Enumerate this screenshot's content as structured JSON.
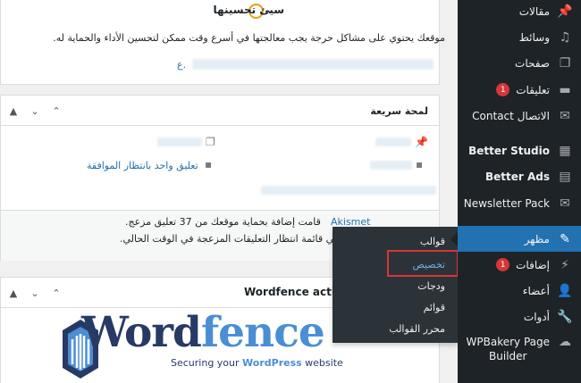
{
  "health": {
    "title": "سيئ تحسينها",
    "description": "موقعك يحتوي على مشاكل حرجة يجب معالجتها في أسرع وقت ممكن لتحسين الأداء والحماية له.",
    "link_fragment": "ع."
  },
  "glance": {
    "title": "لمحة سريعة",
    "pending_comment": "تعليق واحد بانتظار الموافقة",
    "akismet_line1": "قامت إضافة                  بحماية موقعك من 37 تعليق مزعج.",
    "akismet_link": "Akismet",
    "akismet_line2": "لا يوجد أي شيء في قائمة انتظار التعليقات المزعجة في الوقت الحالي."
  },
  "wordfence": {
    "title": "Wordfence activi",
    "logo_word_a": "Word",
    "logo_word_b": "fence",
    "tagline_a": "Securing your ",
    "tagline_b": "WordPress",
    "tagline_c": " website"
  },
  "sidebar": {
    "items": [
      {
        "label": "مقالات",
        "icon": "pin-icon"
      },
      {
        "label": "وسائط",
        "icon": "media-icon"
      },
      {
        "label": "صفحات",
        "icon": "pages-icon"
      },
      {
        "label": "تعليقات",
        "icon": "comments-icon",
        "badge": "1"
      },
      {
        "label": "Contact الاتصال",
        "icon": "mail-icon"
      },
      {
        "label": "Better Studio",
        "icon": "studio-icon"
      },
      {
        "label": "Better Ads",
        "icon": "ads-icon"
      },
      {
        "label": "Newsletter Pack",
        "icon": "newsletter-icon"
      },
      {
        "label": "مظهر",
        "icon": "brush-icon"
      },
      {
        "label": "إضافات",
        "icon": "plugins-icon",
        "badge": "1"
      },
      {
        "label": "أعضاء",
        "icon": "users-icon"
      },
      {
        "label": "أدوات",
        "icon": "tools-icon"
      },
      {
        "label": "WPBakery Page",
        "label2": "Builder",
        "icon": "wpbakery-icon"
      }
    ]
  },
  "flyout": {
    "items": [
      "قوالب",
      "تخصيص",
      "ودجات",
      "قوائم",
      "محرر القوالب"
    ]
  },
  "colors": {
    "sidebar_bg": "#1d2327",
    "accent": "#2271b1",
    "badge": "#d63638",
    "highlight": "#d63638",
    "wordfence_navy": "#273a66",
    "wordfence_blue": "#4a8ed3"
  }
}
